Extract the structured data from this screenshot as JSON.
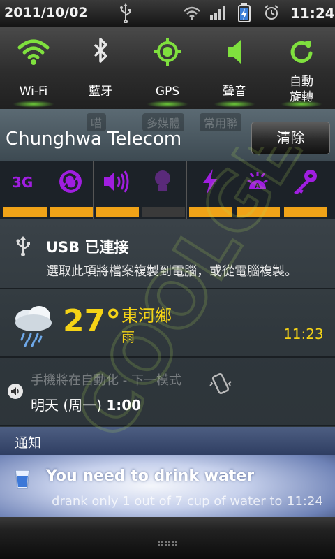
{
  "status_bar": {
    "date": "2011/10/02",
    "time": "11:24",
    "icons": [
      "usb-icon",
      "wifi-icon",
      "signal-icon",
      "battery-charging-icon",
      "alarm-icon"
    ]
  },
  "quick_toggles": [
    {
      "label": "Wi-Fi",
      "icon": "wifi-icon",
      "on": true
    },
    {
      "label": "藍牙",
      "icon": "bluetooth-icon",
      "on": false
    },
    {
      "label": "GPS",
      "icon": "gps-icon",
      "on": true
    },
    {
      "label": "聲音",
      "icon": "sound-icon",
      "on": true
    },
    {
      "label": "自動\n旋轉",
      "line1": "自動",
      "line2": "旋轉",
      "icon": "rotate-icon",
      "on": true
    }
  ],
  "carrier": {
    "name": "Chunghwa Telecom",
    "clear_label": "清除",
    "background_tabs": [
      "喵",
      "多媒體",
      "常用聯"
    ]
  },
  "power_widget": [
    {
      "icon": "3g-icon",
      "label": "3G",
      "on": true
    },
    {
      "icon": "sync-icon",
      "on": true
    },
    {
      "icon": "volume-icon",
      "on": true
    },
    {
      "icon": "bulb-icon",
      "on": false
    },
    {
      "icon": "flash-icon",
      "on": true
    },
    {
      "icon": "brightness-icon",
      "on": true
    },
    {
      "icon": "key-icon",
      "on": true
    }
  ],
  "usb_notification": {
    "title": "USB 已連接",
    "subtitle": "選取此項將檔案複製到電腦，或從電腦複製。"
  },
  "weather": {
    "temperature": "27°",
    "city": "東河鄉",
    "condition": "雨",
    "time": "11:23"
  },
  "alarm": {
    "title": "手機將在自動化 - 下一模式",
    "day": "明天 (周一)",
    "time": "1:00"
  },
  "notifications_header": "通知",
  "water_notification": {
    "title": "You need to drink water",
    "subtitle": "drank only 1 out of 7 cup of water to",
    "time": "11:24"
  },
  "watermark": "COOLGE",
  "colors": {
    "accent_green": "#78e63c",
    "power_on_bar": "#f0a318",
    "power_icon_purple": "#a01ee0",
    "weather_yellow": "#f5d316",
    "notif_header": "#3d4d73"
  }
}
